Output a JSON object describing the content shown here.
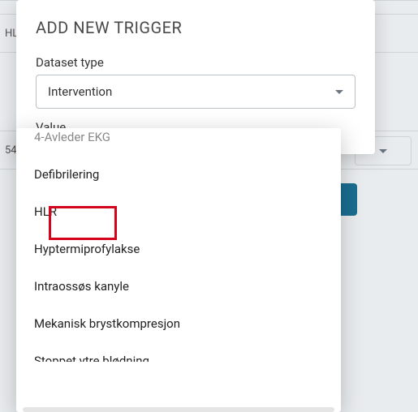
{
  "background": {
    "row1_text": "HL",
    "row2_text": "54"
  },
  "modal": {
    "title": "ADD NEW TRIGGER",
    "dataset_label": "Dataset type",
    "dataset_value": "Intervention",
    "value_label": "Value"
  },
  "dropdown": {
    "options": [
      "4-Avleder EKG",
      "Defibrilering",
      "HLR",
      "Hyptermiprofylakse",
      "Intraossøs kanyle",
      "Mekanisk brystkompresjon",
      "Stoppet ytre blødning"
    ]
  }
}
